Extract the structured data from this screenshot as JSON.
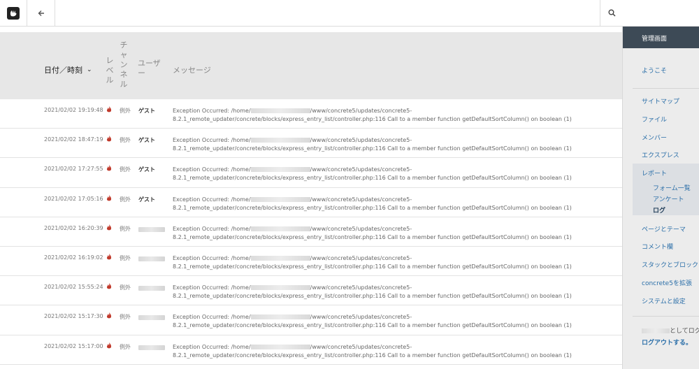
{
  "toolbar": {
    "logo_icon": "concrete5-logo-icon",
    "back_icon": "arrow-left-icon",
    "search_icon": "search-icon"
  },
  "table": {
    "headers": {
      "date": "日付／時刻",
      "level": "レベル",
      "channel": "チャンネル",
      "user": "ユーザー",
      "message": "メッセージ"
    },
    "rows": [
      {
        "date": "2021/02/02 19:19:48",
        "channel": "例外",
        "user": "ゲスト",
        "msg_prefix": "Exception Occurred: /home/",
        "msg_suffix": "/www/concrete5/updates/concrete5-8.2.1_remote_updater/concrete/blocks/express_entry_list/controller.php:116 Call to a member function getDefaultSortColumn() on boolean (1)"
      },
      {
        "date": "2021/02/02 18:47:19",
        "channel": "例外",
        "user": "ゲスト",
        "msg_prefix": "Exception Occurred: /home/",
        "msg_suffix": "/www/concrete5/updates/concrete5-8.2.1_remote_updater/concrete/blocks/express_entry_list/controller.php:116 Call to a member function getDefaultSortColumn() on boolean (1)"
      },
      {
        "date": "2021/02/02 17:27:55",
        "channel": "例外",
        "user": "ゲスト",
        "msg_prefix": "Exception Occurred: /home/",
        "msg_suffix": "/www/concrete5/updates/concrete5-8.2.1_remote_updater/concrete/blocks/express_entry_list/controller.php:116 Call to a member function getDefaultSortColumn() on boolean (1)"
      },
      {
        "date": "2021/02/02 17:05:16",
        "channel": "例外",
        "user": "ゲスト",
        "msg_prefix": "Exception Occurred: /home/",
        "msg_suffix": "/www/concrete5/updates/concrete5-8.2.1_remote_updater/concrete/blocks/express_entry_list/controller.php:116 Call to a member function getDefaultSortColumn() on boolean (1)"
      },
      {
        "date": "2021/02/02 16:20:39",
        "channel": "例外",
        "user": "",
        "msg_prefix": "Exception Occurred: /home/",
        "msg_suffix": "/www/concrete5/updates/concrete5-8.2.1_remote_updater/concrete/blocks/express_entry_list/controller.php:116 Call to a member function getDefaultSortColumn() on boolean (1)"
      },
      {
        "date": "2021/02/02 16:19:02",
        "channel": "例外",
        "user": "",
        "msg_prefix": "Exception Occurred: /home/",
        "msg_suffix": "/www/concrete5/updates/concrete5-8.2.1_remote_updater/concrete/blocks/express_entry_list/controller.php:116 Call to a member function getDefaultSortColumn() on boolean (1)"
      },
      {
        "date": "2021/02/02 15:55:24",
        "channel": "例外",
        "user": "",
        "msg_prefix": "Exception Occurred: /home/",
        "msg_suffix": "/www/concrete5/updates/concrete5-8.2.1_remote_updater/concrete/blocks/express_entry_list/controller.php:116 Call to a member function getDefaultSortColumn() on boolean (1)"
      },
      {
        "date": "2021/02/02 15:17:30",
        "channel": "例外",
        "user": "",
        "msg_prefix": "Exception Occurred: /home/",
        "msg_suffix": "/www/concrete5/updates/concrete5-8.2.1_remote_updater/concrete/blocks/express_entry_list/controller.php:116 Call to a member function getDefaultSortColumn() on boolean (1)"
      },
      {
        "date": "2021/02/02 15:17:00",
        "channel": "例外",
        "user": "",
        "msg_prefix": "Exception Occurred: /home/",
        "msg_suffix": "/www/concrete5/updates/concrete5-8.2.1_remote_updater/concrete/blocks/express_entry_list/controller.php:116 Call to a member function getDefaultSortColumn() on boolean (1)"
      }
    ]
  },
  "sidebar": {
    "header": "管理画面",
    "welcome": "ようこそ",
    "items": [
      "サイトマップ",
      "ファイル",
      "メンバー",
      "エクスプレス",
      "レポート"
    ],
    "report_sub": [
      "フォーム一覧",
      "アンケート",
      "ログ"
    ],
    "items_after": [
      "ページとテーマ",
      "コメント欄",
      "スタックとブロック",
      "concrete5を拡張",
      "システムと設定"
    ],
    "login_text": "としてログ",
    "logout": "ログアウトする。"
  },
  "colors": {
    "sidebar_header_bg": "#3d4a56",
    "link": "#2a6ea8",
    "level_icon": "#c0392b"
  }
}
